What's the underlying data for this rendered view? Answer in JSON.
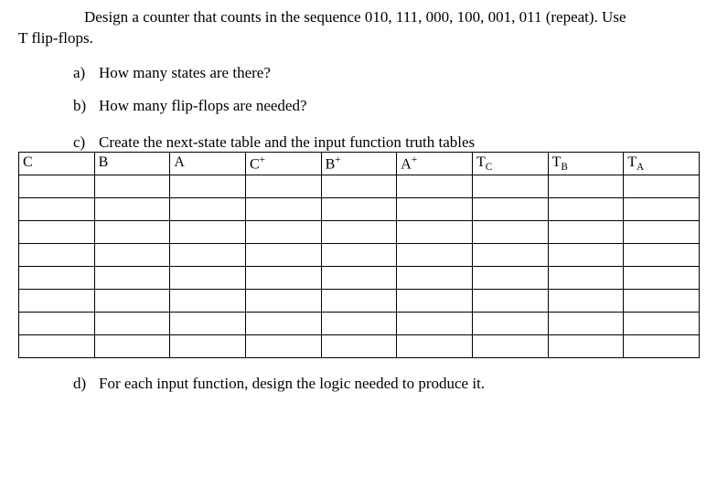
{
  "intro": {
    "text_part1": "Design a counter that counts in the sequence  010, 111, 000, 100, 001, 011 (repeat). Use",
    "text_part2": "T flip-flops."
  },
  "questions": {
    "a": {
      "label": "a)",
      "text": "How many states are there?"
    },
    "b": {
      "label": "b)",
      "text": "How many flip-flops are needed?"
    },
    "c": {
      "label": "c)",
      "text": "Create the next-state table and the input function truth tables"
    },
    "d": {
      "label": "d)",
      "text": "For each input function, design the logic needed to produce it."
    }
  },
  "table": {
    "headers": {
      "col0": "C",
      "col1": "B",
      "col2": "A",
      "col3_base": "C",
      "col3_sup": "+",
      "col4_base": "B",
      "col4_sup": "+",
      "col5_base": "A",
      "col5_sup": "+",
      "col6_base": "T",
      "col6_sub": "C",
      "col7_base": "T",
      "col7_sub": "B",
      "col8_base": "T",
      "col8_sub": "A"
    },
    "rows": 8
  }
}
